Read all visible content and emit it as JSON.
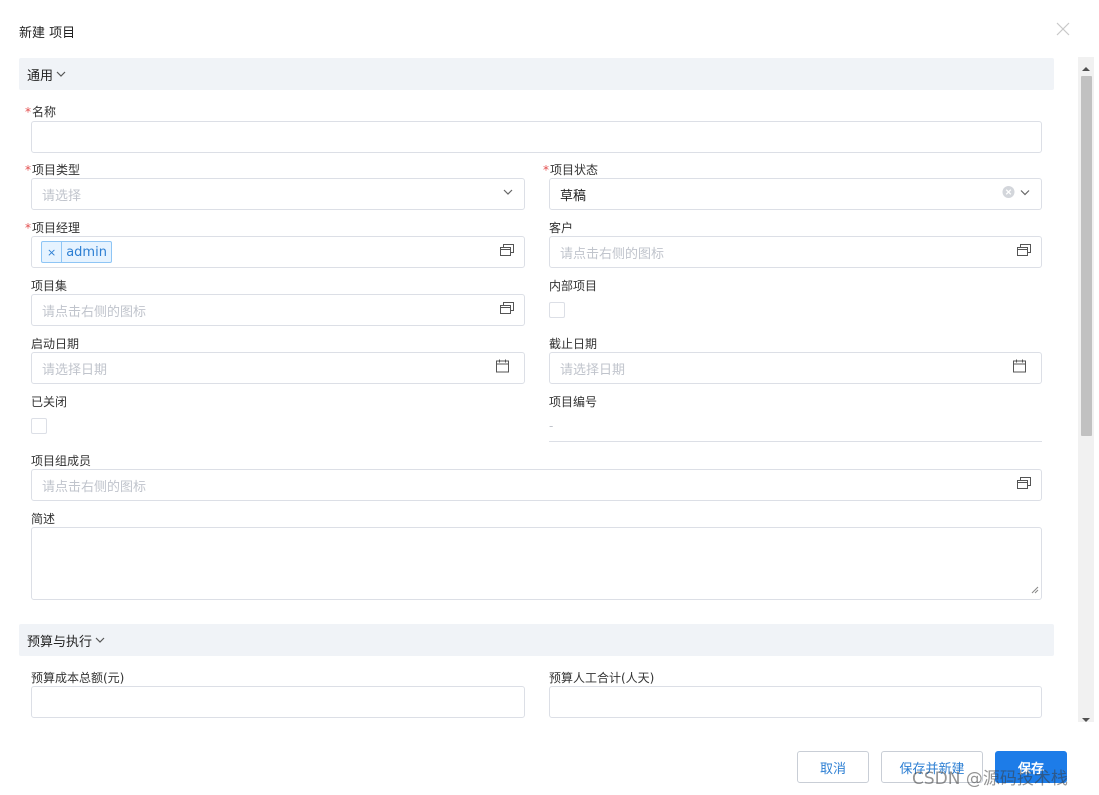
{
  "dialog": {
    "title": "新建 项目"
  },
  "sections": {
    "general": {
      "label": "通用"
    },
    "budget": {
      "label": "预算与执行"
    }
  },
  "fields": {
    "name": {
      "label": "名称",
      "required": true,
      "value": ""
    },
    "project_type": {
      "label": "项目类型",
      "required": true,
      "placeholder": "请选择"
    },
    "project_status": {
      "label": "项目状态",
      "required": true,
      "value": "草稿"
    },
    "project_manager": {
      "label": "项目经理",
      "required": true,
      "tag_remove": "×",
      "tag": "admin"
    },
    "customer": {
      "label": "客户",
      "placeholder": "请点击右侧的图标"
    },
    "project_set": {
      "label": "项目集",
      "placeholder": "请点击右侧的图标"
    },
    "internal_project": {
      "label": "内部项目",
      "checked": false
    },
    "start_date": {
      "label": "启动日期",
      "placeholder": "请选择日期"
    },
    "end_date": {
      "label": "截止日期",
      "placeholder": "请选择日期"
    },
    "closed": {
      "label": "已关闭",
      "checked": false
    },
    "project_code": {
      "label": "项目编号",
      "value": "-"
    },
    "members": {
      "label": "项目组成员",
      "placeholder": "请点击右侧的图标"
    },
    "description": {
      "label": "简述",
      "value": ""
    },
    "budget_cost": {
      "label": "预算成本总额(元)",
      "value": ""
    },
    "budget_labor": {
      "label": "预算人工合计(人天)",
      "value": ""
    }
  },
  "footer": {
    "cancel_label": "取消",
    "save_new_label": "保存并新建",
    "save_label": "保存"
  },
  "watermark": "CSDN @源码技术栈",
  "colors": {
    "primary": "#1d7ce8",
    "required": "#e34d4d",
    "section_bg": "#f0f3f7",
    "tag_bg": "#e6f3ff"
  },
  "icons": {
    "close": "close-icon",
    "chevron": "chevron-down-icon",
    "picker": "picker-window-icon",
    "calendar": "calendar-icon",
    "clear": "clear-circle-icon"
  }
}
